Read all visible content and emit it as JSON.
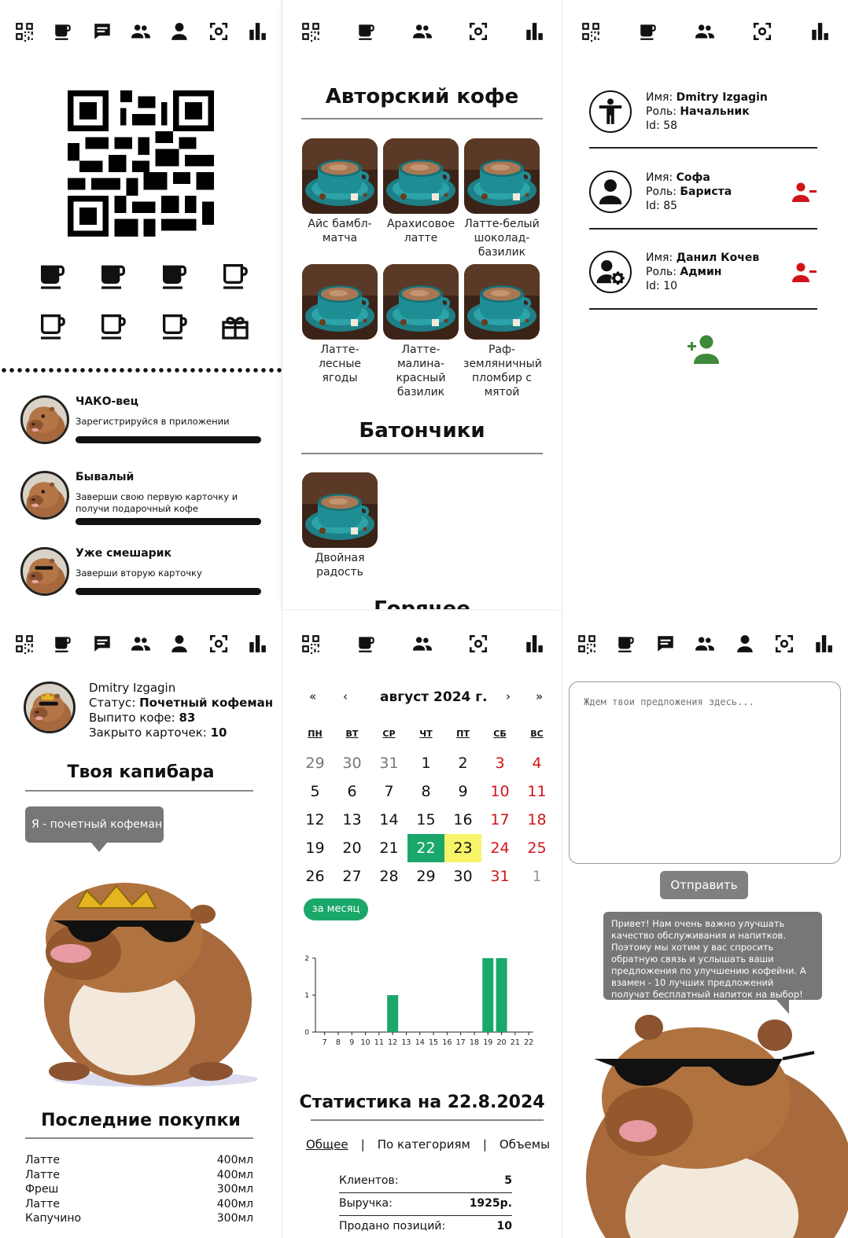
{
  "panel1": {
    "achievements": [
      {
        "title": "ЧАКО-вец",
        "desc": "Зарегистрируйся в приложении",
        "progress": 1.0
      },
      {
        "title": "Бывалый",
        "desc": "Заверши свою первую карточку и получи подарочный кофе",
        "progress": 1.0
      },
      {
        "title": "Уже смешарик",
        "desc": "Заверши вторую карточку",
        "progress": 1.0
      }
    ],
    "stamps_filled": 3,
    "stamps_total": 7
  },
  "panel2": {
    "section1": "Авторский кофе",
    "items": [
      "Айс бамбл-матча",
      "Арахисовое латте",
      "Латте-белый шоколад-базилик",
      "Латте-лесные ягоды",
      "Латте-малина-красный базилик",
      "Раф-земляничный пломбир с мятой"
    ],
    "section2": "Батончики",
    "items2": [
      "Двойная радость"
    ],
    "section3": "Горячее"
  },
  "panel3": {
    "users": [
      {
        "name_label": "Имя:",
        "name": "Dmitry Izgagin",
        "role_label": "Роль:",
        "role": "Начальник",
        "id_label": "Id:",
        "id": "58"
      },
      {
        "name_label": "Имя:",
        "name": "Софа",
        "role_label": "Роль:",
        "role": "Бариста",
        "id_label": "Id:",
        "id": "85"
      },
      {
        "name_label": "Имя:",
        "name": "Данил Кочев",
        "role_label": "Роль:",
        "role": "Админ",
        "id_label": "Id:",
        "id": "10"
      }
    ]
  },
  "panel4": {
    "name": "Dmitry Izgagin",
    "status_label": "Статус:",
    "status": "Почетный кофеман",
    "drunk_label": "Выпито кофе:",
    "drunk": "83",
    "cards_label": "Закрыто карточек:",
    "cards": "10",
    "capy_title": "Твоя капибара",
    "bubble": "Я - почетный кофеман",
    "purchases_title": "Последние покупки",
    "purchases": [
      {
        "name": "Латте",
        "vol": "400мл"
      },
      {
        "name": "Латте",
        "vol": "400мл"
      },
      {
        "name": "Фреш",
        "vol": "300мл"
      },
      {
        "name": "Латте",
        "vol": "400мл"
      },
      {
        "name": "Капучино",
        "vol": "300мл"
      }
    ]
  },
  "panel5": {
    "nav": {
      "prev_year": "«",
      "prev": "‹",
      "month": "август 2024 г.",
      "next": "›",
      "next_year": "»"
    },
    "dow": [
      "ПН",
      "ВТ",
      "СР",
      "ЧТ",
      "ПТ",
      "СБ",
      "ВС"
    ],
    "weeks": [
      [
        "29",
        "30",
        "31",
        "1",
        "2",
        "3",
        "4"
      ],
      [
        "5",
        "6",
        "7",
        "8",
        "9",
        "10",
        "11"
      ],
      [
        "12",
        "13",
        "14",
        "15",
        "16",
        "17",
        "18"
      ],
      [
        "19",
        "20",
        "21",
        "22",
        "23",
        "24",
        "25"
      ],
      [
        "26",
        "27",
        "28",
        "29",
        "30",
        "31",
        "1"
      ]
    ],
    "selected_day": "22",
    "today_day": "23",
    "month_btn": "за месяц",
    "stats_title": "Статистика на 22.8.2024",
    "tabs": [
      "Общее",
      "|",
      "По категориям",
      "|",
      "Объемы"
    ],
    "rows": [
      {
        "label": "Клиентов:",
        "value": "5"
      },
      {
        "label": "Выручка:",
        "value": "1925р."
      },
      {
        "label": "Продано позиций:",
        "value": "10"
      }
    ]
  },
  "chart_data": {
    "type": "bar",
    "categories": [
      "7",
      "8",
      "9",
      "10",
      "11",
      "12",
      "13",
      "14",
      "15",
      "16",
      "17",
      "18",
      "19",
      "20",
      "21",
      "22"
    ],
    "values": [
      0,
      0,
      0,
      0,
      0,
      1,
      0,
      0,
      0,
      0,
      0,
      0,
      2,
      2,
      0,
      0
    ],
    "ylim": [
      0,
      2
    ],
    "yticks": [
      "0",
      "1",
      "2"
    ],
    "color": "#1aa86a"
  },
  "panel6": {
    "placeholder": "Ждем твои предложения здесь...",
    "send": "Отправить",
    "bubble": "Привет! Нам очень важно улучшать качество обслуживания и напитков. Поэтому мы хотим у вас спросить обратную связь и услышать ваши предложения по улучшению кофейни. А взамен - 10 лучших предложений получат бесплатный напиток на выбор!"
  },
  "colors": {
    "accent": "#1aa86a",
    "danger": "#d0141a",
    "add": "#3f8a3a",
    "today": "#f7f46a"
  }
}
